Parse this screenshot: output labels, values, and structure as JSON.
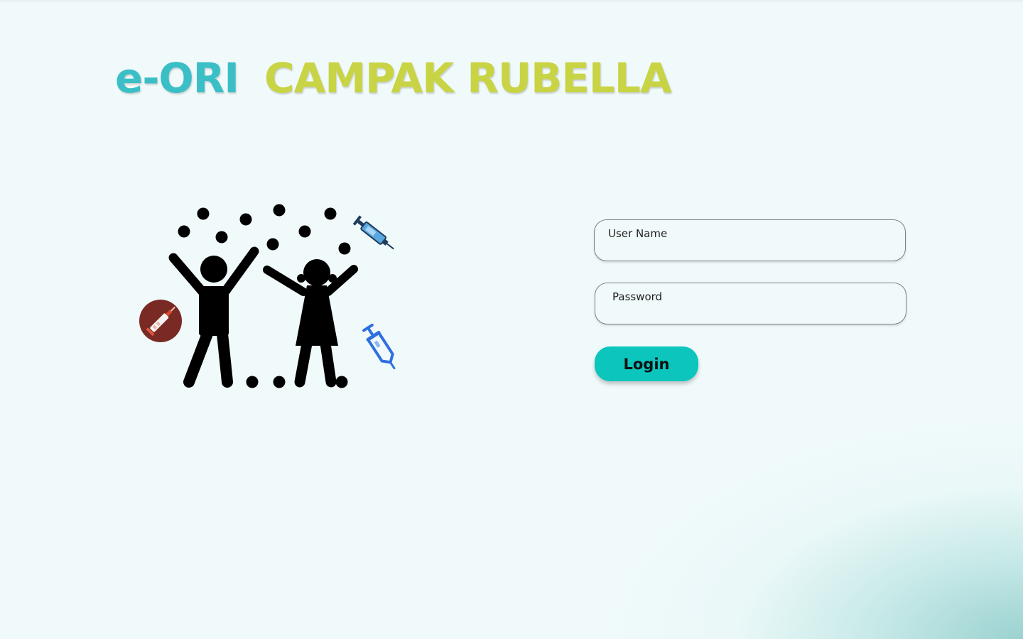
{
  "header": {
    "brand_prefix": "e-ORI",
    "brand_title": "CAMPAK RUBELLA"
  },
  "login_form": {
    "username": {
      "placeholder": "User Name",
      "value": ""
    },
    "password": {
      "placeholder": "Password",
      "value": ""
    },
    "login_label": "Login"
  },
  "colors": {
    "brand_prefix": "#3bbfc6",
    "brand_title": "#c8d444",
    "login_button": "#0cc5bd",
    "background": "#f1fafb",
    "corner_gradient": "#96d0ce",
    "syringe_blue": "#2f6fe0",
    "syringe_badge": "#7a2a24"
  },
  "illustration": {
    "icons": [
      "children-celebrating-icon",
      "syringe-badge-icon",
      "syringe-icon",
      "vaccine-syringe-icon"
    ]
  }
}
